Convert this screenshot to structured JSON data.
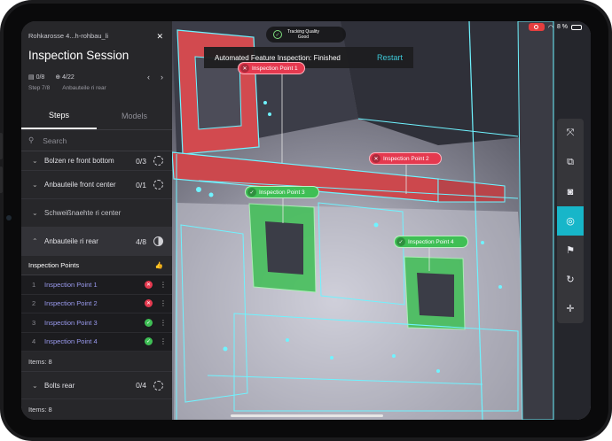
{
  "status_bar": {
    "battery": "8 %"
  },
  "tracking": {
    "line1": "Tracking Quality",
    "line2": "Good"
  },
  "notification": {
    "message": "Automated Feature Inspection: Finished",
    "action": "Restart"
  },
  "ar_labels": [
    {
      "label": "Inspection Point 1",
      "status": "failed"
    },
    {
      "label": "Inspection Point 2",
      "status": "failed"
    },
    {
      "label": "Inspection Point 3",
      "status": "passed"
    },
    {
      "label": "Inspection Point 4",
      "status": "passed"
    }
  ],
  "panel": {
    "file_name": "Rohkarosse 4...h-rohbau_li",
    "title": "Inspection Session",
    "checks": "0/8",
    "points": "4/22",
    "step": "Step 7/8",
    "step_name": "Anbauteile ri rear",
    "tabs": [
      "Steps",
      "Models"
    ],
    "search_placeholder": "Search",
    "steps": [
      {
        "name": "Bolzen re front bottom",
        "count": "0/3"
      },
      {
        "name": "Anbauteile front center",
        "count": "0/1"
      },
      {
        "name": "Schweißnaehte ri center",
        "count": ""
      },
      {
        "name": "Anbauteile ri rear",
        "count": "4/8"
      }
    ],
    "section_title": "Inspection Points",
    "inspection_points": [
      {
        "num": "1",
        "name": "Inspection Point 1",
        "status": "failed"
      },
      {
        "num": "2",
        "name": "Inspection Point 2",
        "status": "failed"
      },
      {
        "num": "3",
        "name": "Inspection Point 3",
        "status": "passed"
      },
      {
        "num": "4",
        "name": "Inspection Point 4",
        "status": "passed"
      }
    ],
    "items_label": "Items: 8",
    "bolts_step": {
      "name": "Bolts rear",
      "count": "0/4"
    },
    "footer_items": "Items: 8"
  },
  "colors": {
    "accent": "#17b6c9",
    "failed": "#e5394f",
    "passed": "#3fbf55",
    "panel": "#27272a"
  }
}
